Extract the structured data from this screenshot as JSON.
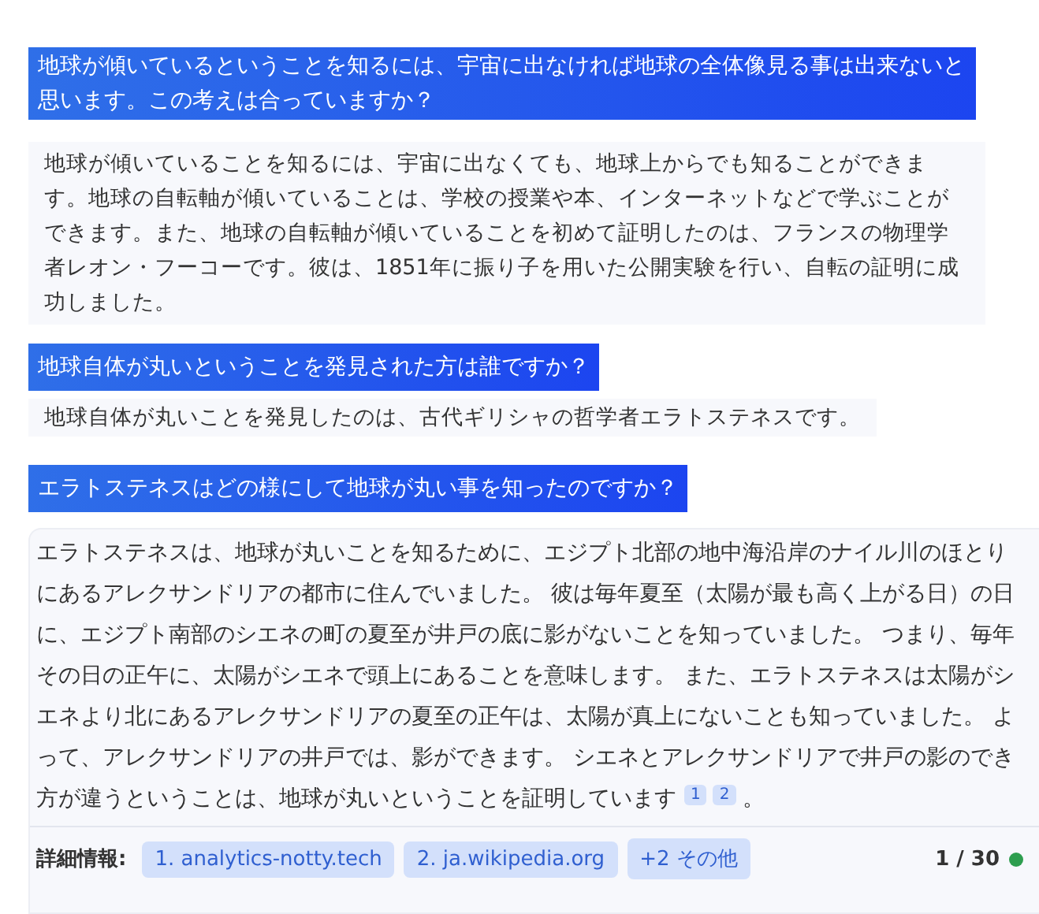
{
  "messages": [
    {
      "kind": "question",
      "text": "地球が傾いているということを知るには、宇宙に出なければ地球の全体像見る事は出来ないと思います。この考えは合っていますか？"
    },
    {
      "kind": "answer",
      "text": "地球が傾いていることを知るには、宇宙に出なくても、地球上からでも知ることができます。地球の自転軸が傾いていることは、学校の授業や本、インターネットなどで学ぶことができます。また、地球の自転軸が傾いていることを初めて証明したのは、フランスの物理学者レオン・フーコーです。彼は、1851年に振り子を用いた公開実験を行い、自転の証明に成功しました。"
    },
    {
      "kind": "question",
      "text": "地球自体が丸いということを発見された方は誰ですか？"
    },
    {
      "kind": "answer",
      "text": "地球自体が丸いことを発見したのは、古代ギリシャの哲学者エラトステネスです。"
    },
    {
      "kind": "question",
      "text": "エラトステネスはどの様にして地球が丸い事を知ったのですか？"
    }
  ],
  "final_answer": {
    "text": "エラトステネスは、地球が丸いことを知るために、エジプト北部の地中海沿岸のナイル川のほとりにあるアレクサンドリアの都市に住んでいました。 彼は毎年夏至（太陽が最も高く上がる日）の日に、エジプト南部のシエネの町の夏至が井戸の底に影がないことを知っていました。 つまり、毎年その日の正午に、太陽がシエネで頭上にあることを意味します。 また、エラトステネスは太陽がシエネより北にあるアレクサンドリアの夏至の正午は、太陽が真上にないことも知っていました。 よって、アレクサンドリアの井戸では、影ができます。 シエネとアレクサンドリアで井戸の影のでき方が違うということは、地球が丸いということを証明しています",
    "citations": [
      "1",
      "2"
    ],
    "text_end": "。",
    "footer": {
      "label": "詳細情報:",
      "sources": [
        "1. analytics-notty.tech",
        "2. ja.wikipedia.org",
        "+2 その他"
      ],
      "count": "1 / 30"
    }
  }
}
